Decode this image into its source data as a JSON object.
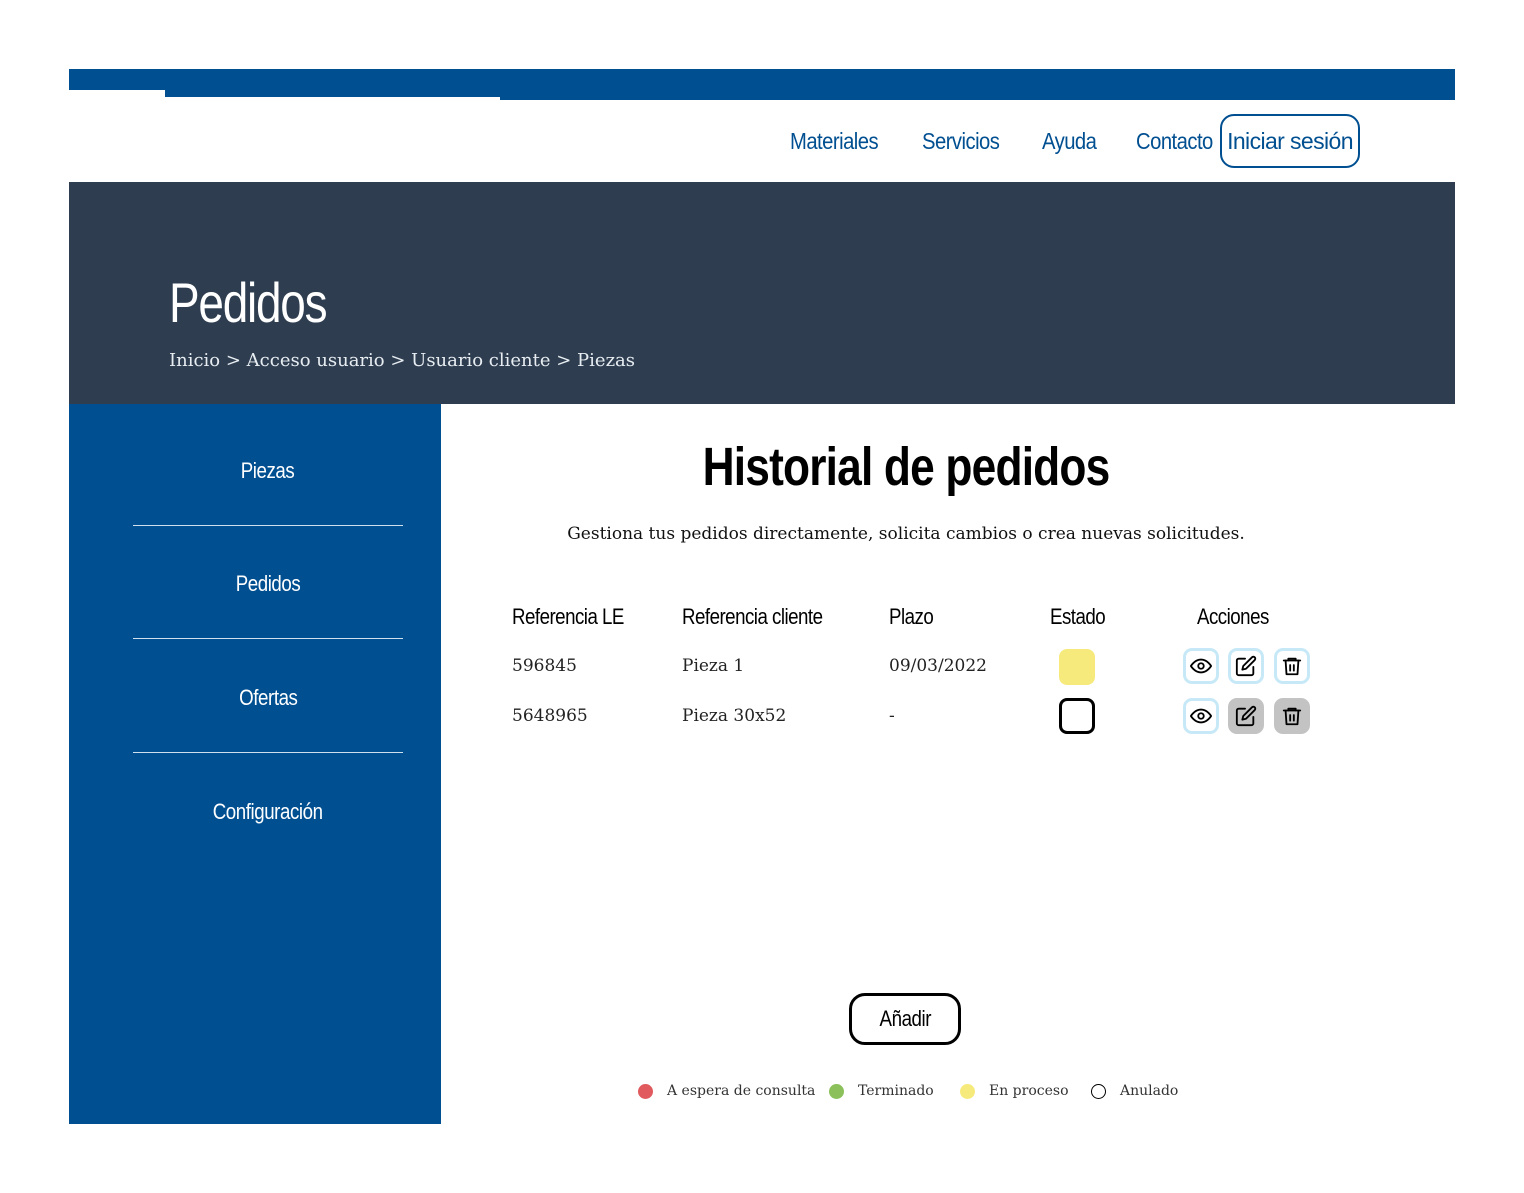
{
  "nav": {
    "items": [
      {
        "label": "Materiales"
      },
      {
        "label": "Servicios"
      },
      {
        "label": "Ayuda"
      },
      {
        "label": "Contacto"
      }
    ],
    "login_label": "Iniciar sesión"
  },
  "hero": {
    "title": "Pedidos",
    "breadcrumb": "Inicio > Acceso usuario > Usuario cliente > Piezas"
  },
  "sidebar": {
    "items": [
      {
        "label": "Piezas"
      },
      {
        "label": "Pedidos"
      },
      {
        "label": "Ofertas"
      },
      {
        "label": "Configuración"
      }
    ]
  },
  "main": {
    "title": "Historial de pedidos",
    "subtitle": "Gestiona tus pedidos directamente, solicita cambios o crea nuevas solicitudes.",
    "columns": [
      "Referencia LE",
      "Referencia cliente",
      "Plazo",
      "Estado",
      "Acciones"
    ],
    "rows": [
      {
        "ref_le": "596845",
        "ref_cliente": "Pieza 1",
        "plazo": "09/03/2022",
        "estado": "En proceso",
        "edit_enabled": true,
        "delete_enabled": true
      },
      {
        "ref_le": "5648965",
        "ref_cliente": "Pieza 30x52",
        "plazo": "-",
        "estado": "Anulado",
        "edit_enabled": false,
        "delete_enabled": false
      }
    ],
    "add_label": "Añadir"
  },
  "legend": [
    {
      "label": "A espera de consulta",
      "color": "#e05a5e"
    },
    {
      "label": "Terminado",
      "color": "#8bc05a"
    },
    {
      "label": "En proceso",
      "color": "#f6ea7c"
    },
    {
      "label": "Anulado",
      "color": "#ffffff"
    }
  ],
  "colors": {
    "brand_blue": "#004f91",
    "hero_bg": "#2e3e50",
    "action_border": "#c7e9f7",
    "disabled": "#c3c3c3"
  }
}
